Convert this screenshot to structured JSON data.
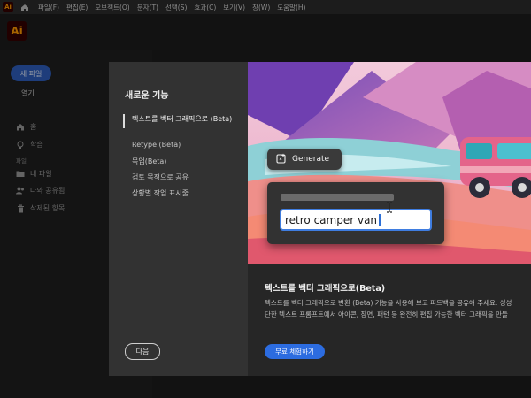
{
  "app": {
    "logo_text": "Ai",
    "mini_logo_text": "Ai",
    "home_icon": "home-icon"
  },
  "menubar": {
    "items": [
      "파일(F)",
      "편집(E)",
      "오브젝트(O)",
      "문자(T)",
      "선택(S)",
      "효과(C)",
      "보기(V)",
      "창(W)",
      "도움말(H)"
    ]
  },
  "sidebar": {
    "new_file": "새 파일",
    "open": "열기",
    "home": "홈",
    "learn": "학습",
    "files_section": "파일",
    "my_files": "내 파일",
    "shared": "나와 공유됨",
    "deleted": "삭제된 항목"
  },
  "modal": {
    "title": "새로운 기능",
    "features": [
      "텍스트를 벡터 그래픽으로 (Beta)",
      "Retype (Beta)",
      "목업(Beta)",
      "검토 목적으로 공유",
      "상황별 작업 표시줄"
    ],
    "active_index": 0,
    "next_label": "다음",
    "hero": {
      "generate_label": "Generate",
      "prompt_value": "retro camper van"
    },
    "feature_title": "텍스트를 벡터 그래픽으로(Beta)",
    "feature_desc_line1": "텍스트를 벡터 그래픽으로 변환 (Beta) 기능을 사용해 보고 피드백을 공유해 주세요. 성성",
    "feature_desc_line2": "단한 텍스트 프롬프트에서 아이콘, 장면, 패턴 등 완전히 편집 가능한 벡터 그래픽을 만들",
    "try_label": "무료 체험하기"
  },
  "colors": {
    "accent": "#2c6ce0",
    "brand_bg": "#330000",
    "brand_fg": "#ff9a00"
  }
}
